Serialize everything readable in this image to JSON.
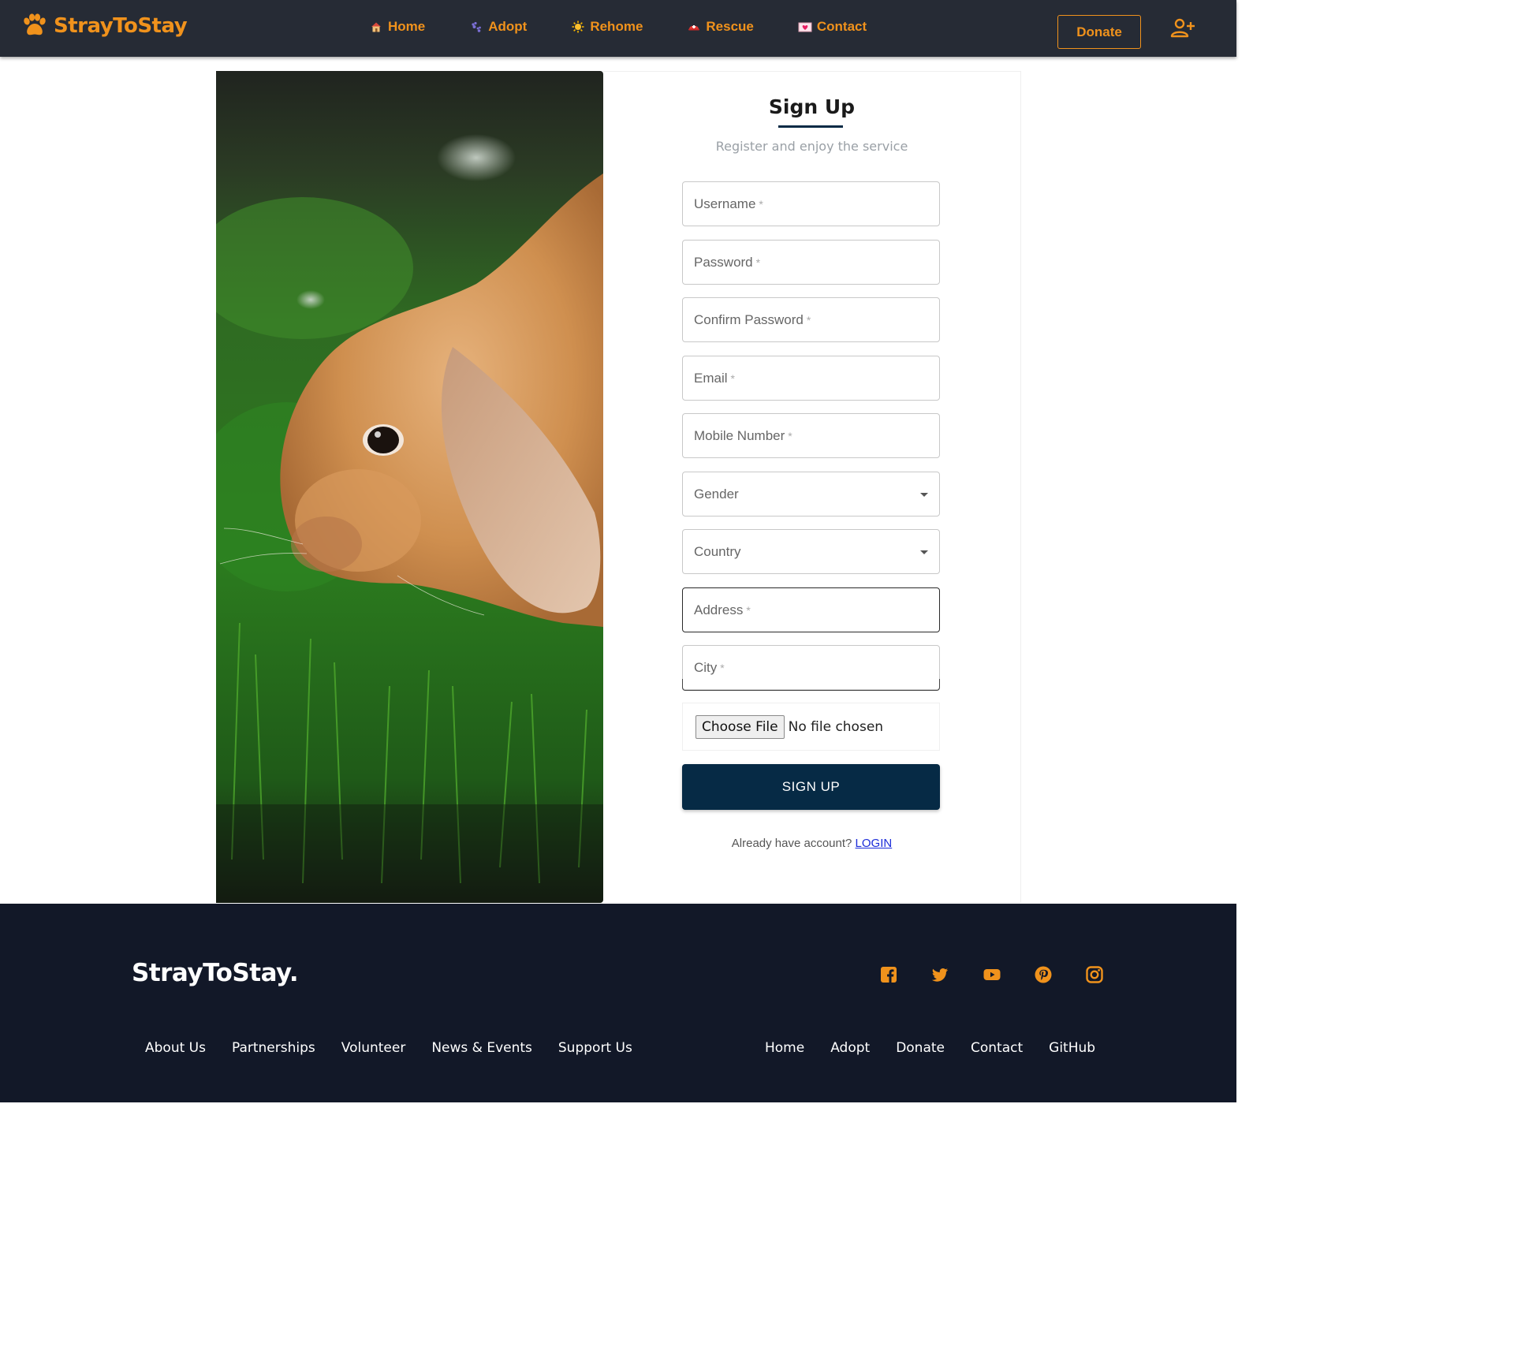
{
  "navbar": {
    "brand": "StrayToStay",
    "links": [
      {
        "label": "Home",
        "icon": "house-emoji-icon"
      },
      {
        "label": "Adopt",
        "icon": "paw-prints-emoji-icon"
      },
      {
        "label": "Rehome",
        "icon": "sun-emoji-icon"
      },
      {
        "label": "Rescue",
        "icon": "rescue-helmet-emoji-icon"
      },
      {
        "label": "Contact",
        "icon": "love-letter-emoji-icon"
      }
    ],
    "donate_label": "Donate",
    "accent_color": "#f0921c",
    "background_color": "#262b35"
  },
  "form": {
    "title": "Sign Up",
    "subtitle": "Register and enjoy the service",
    "fields": {
      "username": {
        "label": "Username",
        "required": "*"
      },
      "password": {
        "label": "Password",
        "required": "*"
      },
      "confirm_password": {
        "label": "Confirm Password",
        "required": "*"
      },
      "email": {
        "label": "Email",
        "required": "*"
      },
      "mobile": {
        "label": "Mobile Number",
        "required": "*"
      },
      "gender": {
        "label": "Gender"
      },
      "country": {
        "label": "Country"
      },
      "address": {
        "label": "Address",
        "required": "*"
      },
      "city": {
        "label": "City",
        "required": "*"
      }
    },
    "file": {
      "button_label": "Choose File",
      "status": "No file chosen"
    },
    "submit_label": "SIGN UP",
    "login_prompt": "Already have account?",
    "login_link": "LOGIN",
    "primary_color": "#062a45"
  },
  "footer": {
    "brand": "StrayToStay.",
    "social_icons": [
      "facebook-icon",
      "twitter-icon",
      "youtube-icon",
      "pinterest-icon",
      "instagram-icon"
    ],
    "links_left": [
      "About Us",
      "Partnerships",
      "Volunteer",
      "News & Events",
      "Support Us"
    ],
    "links_right": [
      "Home",
      "Adopt",
      "Donate",
      "Contact",
      "GitHub"
    ],
    "background_color": "#121828"
  }
}
